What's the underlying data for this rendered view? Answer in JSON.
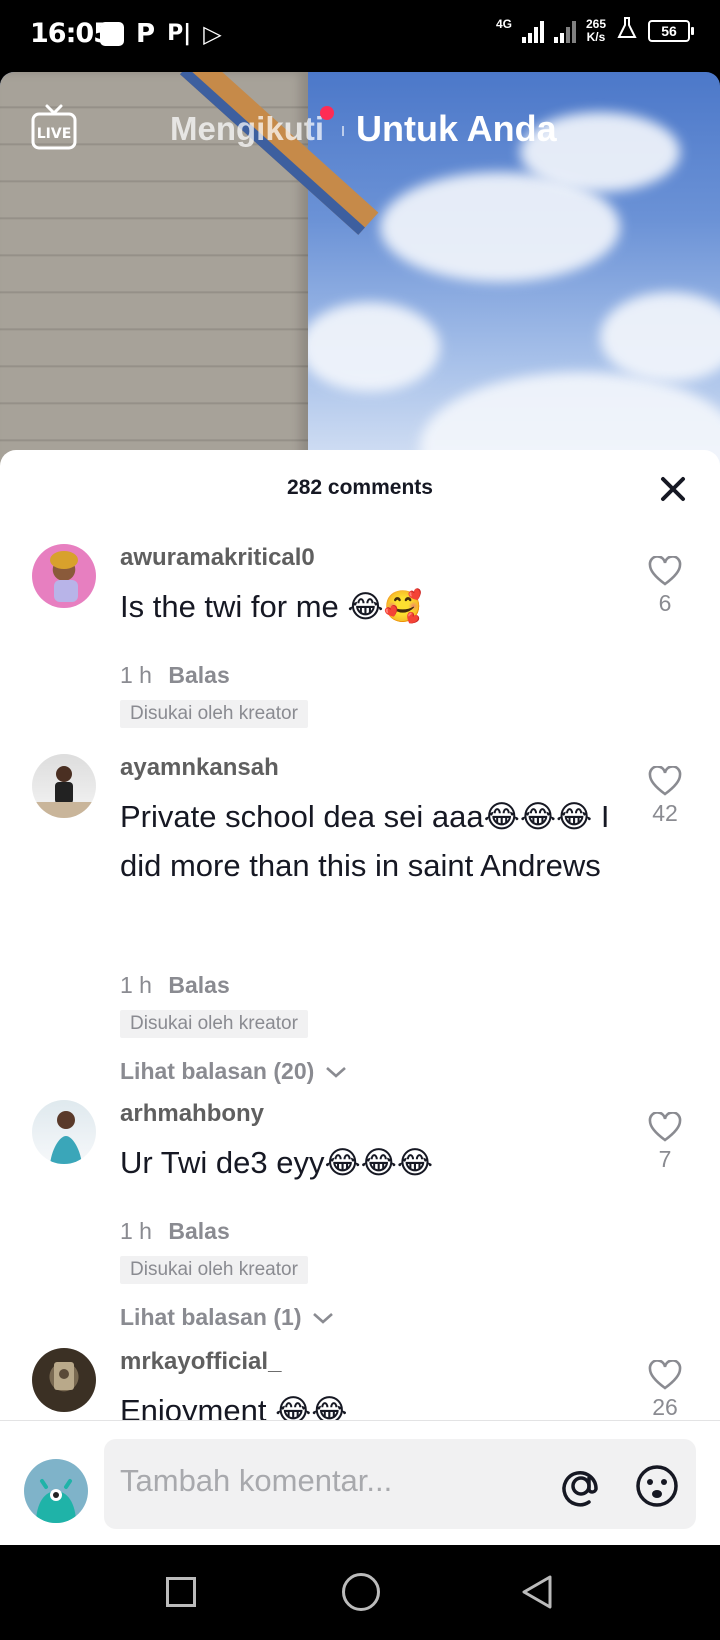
{
  "status_bar": {
    "time": "16:05",
    "network_type": "4G",
    "speed_value": "265",
    "speed_unit": "K/s",
    "battery": "56",
    "app_icons": [
      "P",
      "P|",
      "▷"
    ]
  },
  "top_nav": {
    "live_label": "LIVE",
    "following": "Mengikuti",
    "for_you": "Untuk Anda"
  },
  "comments_sheet": {
    "count_label": "282 comments",
    "comments": [
      {
        "username": "awuramakritical0",
        "text": "Is the twi for me 😂🥰",
        "time": "1 h",
        "reply_label": "Balas",
        "badge": "Disukai oleh kreator",
        "likes": "6",
        "view_replies": ""
      },
      {
        "username": "ayamnkansah",
        "text": "Private school dea sei aaa😂😂😂 I did more than this in saint Andrews",
        "time": "1 h",
        "reply_label": "Balas",
        "badge": "Disukai oleh kreator",
        "likes": "42",
        "view_replies": "Lihat balasan (20)"
      },
      {
        "username": "arhmahbony",
        "text": "Ur Twi de3 eyy😂😂😂",
        "time": "1 h",
        "reply_label": "Balas",
        "badge": "Disukai oleh kreator",
        "likes": "7",
        "view_replies": "Lihat balasan (1)"
      },
      {
        "username": "mrkayofficial_",
        "text": "Enjoyment 😂😂",
        "time": "",
        "reply_label": "",
        "badge": "",
        "likes": "26",
        "view_replies": ""
      }
    ]
  },
  "input_bar": {
    "placeholder": "Tambah komentar...",
    "mention_icon": "at-icon",
    "emoji_icon": "emoji-icon"
  },
  "colors": {
    "accent_red": "#fe2c55",
    "text_primary": "#161823",
    "text_secondary": "#8a8b91"
  }
}
